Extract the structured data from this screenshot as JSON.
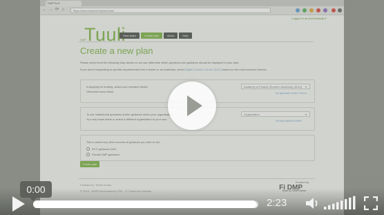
{
  "browser": {
    "tab_title": "DMPTuuli",
    "url": "https://www.dmptuuli.fi/plans/new",
    "nav": {
      "back": "←",
      "forward": "→",
      "reload": "⟳",
      "home": "⌂"
    }
  },
  "site": {
    "logged_in": "Logged in as testi.testaaja ▾",
    "logo_prefix": "DMP",
    "logo": "Tuuli",
    "menu": [
      {
        "label": "View plans",
        "active": false
      },
      {
        "label": "Create plan",
        "active": true
      },
      {
        "label": "About",
        "active": false
      },
      {
        "label": "Help",
        "active": false
      }
    ],
    "page_title": "Create a new plan",
    "intro_1": "Please select from the following drop-downs so we can determine which questions and guidance should be displayed in your plan.",
    "intro_2_a": "If you aren't responding to specific requirements from a funder or an institution, select ",
    "intro_2_link": "Digital Curation Centre (DCC)",
    "intro_2_b": " based on the most common themes.",
    "funder_box": {
      "line1": "If applying for funding, select your research funder.",
      "line2": "Otherwise leave blank.",
      "select_value": "Academy of Finland (Suomen Akatemia) (2014)",
      "link": "No applicable funder? Select"
    },
    "org_box": {
      "line1": "To see institutional questions and/or guidance select your organisation.",
      "line2": "You may leave blank or select a different organisation to your own.",
      "select_value": "Organisation",
      "link": "Not applicable/Not listed"
    },
    "guidance_box": {
      "line1": "Tick to select any other sources of guidance you wish to see.",
      "options": [
        "DCC guidance (UK)",
        "Finnish DMP guidance"
      ]
    },
    "create_button": "Create plan",
    "footer": {
      "links": "Contact us  |  Terms of use",
      "copyright": "© 2015 - DMPTuuli hosted by CSC - IT Center for Science",
      "funded_by": "Funded by:",
      "funded_logo": "Fi DMP",
      "powered_by": "Built on DMPonline"
    }
  },
  "player": {
    "current_time": "0:00",
    "duration": "2:23",
    "progress_fraction": 0.99,
    "volume_level": 1.0,
    "icons": [
      "play-icon",
      "big-play-icon",
      "volume-icon",
      "fullscreen-icon"
    ]
  }
}
